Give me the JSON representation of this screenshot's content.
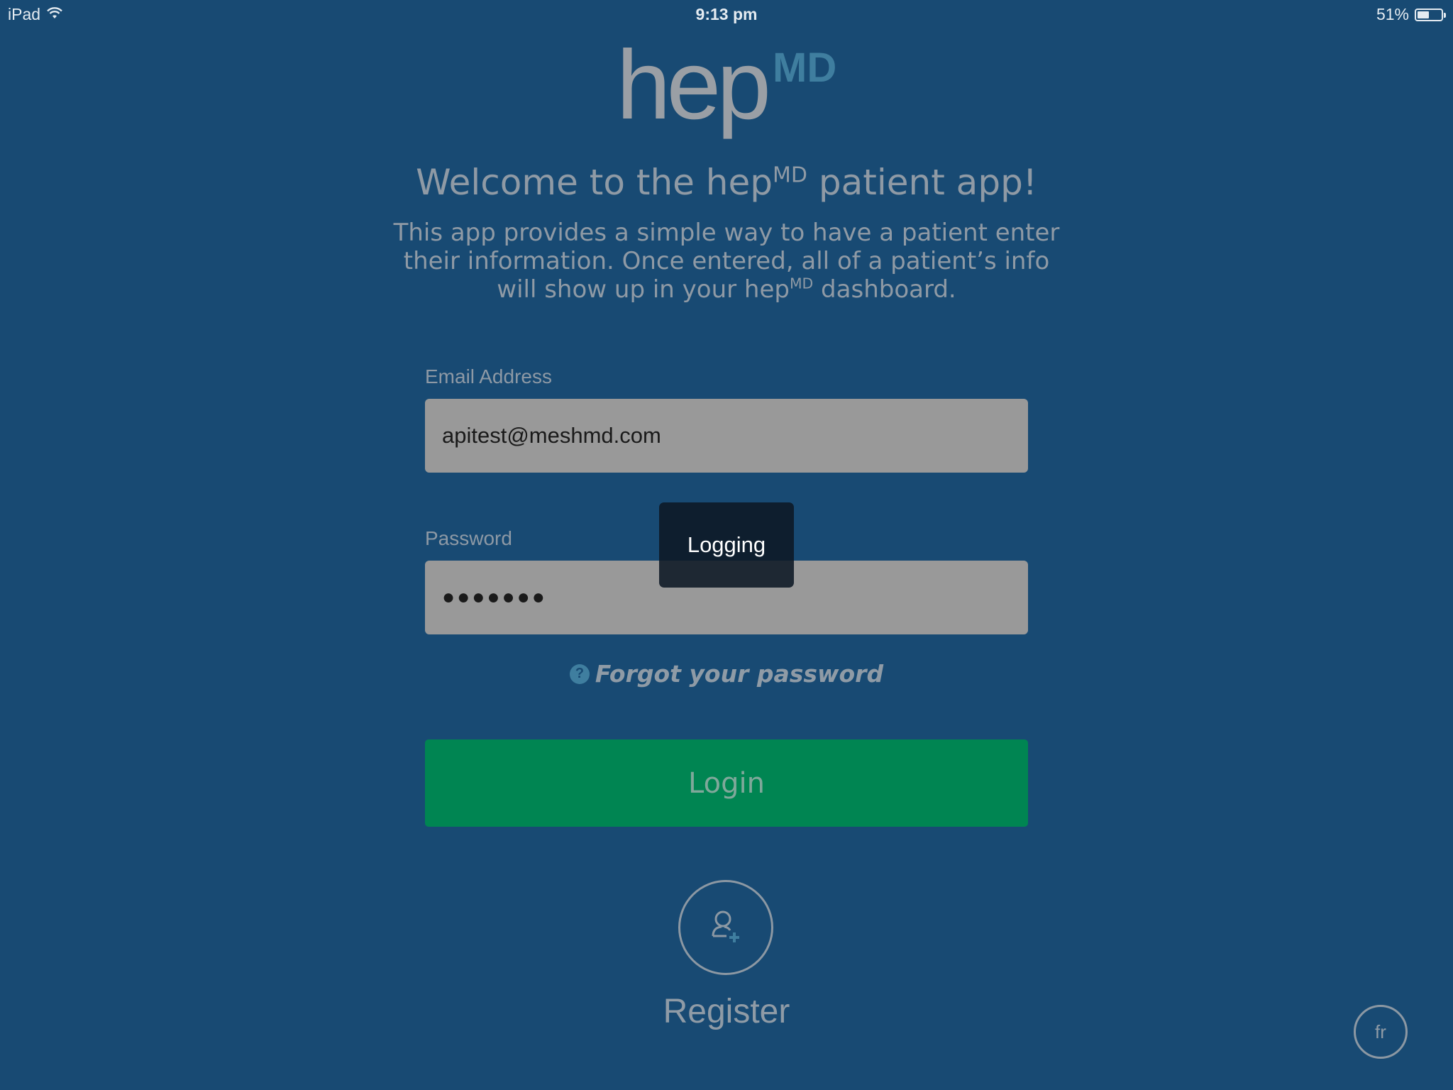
{
  "status_bar": {
    "device": "iPad",
    "time": "9:13 pm",
    "battery_percent": "51%",
    "battery_level": 0.51,
    "wifi_icon": "wifi-icon",
    "battery_icon": "battery-icon"
  },
  "logo": {
    "hep": "hep",
    "md": "MD"
  },
  "welcome": {
    "prefix": "Welcome to the hep",
    "sup": "MD",
    "suffix": " patient app!"
  },
  "description": {
    "line1": "This app provides a simple way to have a patient enter",
    "line2": "their information. Once entered, all of a patient’s info",
    "line3_prefix": "will show up in your hep",
    "line3_sup": "MD",
    "line3_suffix": " dashboard."
  },
  "form": {
    "email_label": "Email Address",
    "email_value": "apitest@meshmd.com",
    "password_label": "Password",
    "password_value": "●●●●●●●",
    "forgot_icon": "question-icon",
    "forgot_text": "Forgot your password",
    "login_label": "Login"
  },
  "register": {
    "icon": "add-user-icon",
    "label": "Register"
  },
  "language": {
    "label": "fr"
  },
  "overlay": {
    "text": "Logging"
  },
  "colors": {
    "background": "#184a73",
    "login_button": "#008552",
    "field_background": "#999999",
    "accent": "#3f7e9f"
  }
}
